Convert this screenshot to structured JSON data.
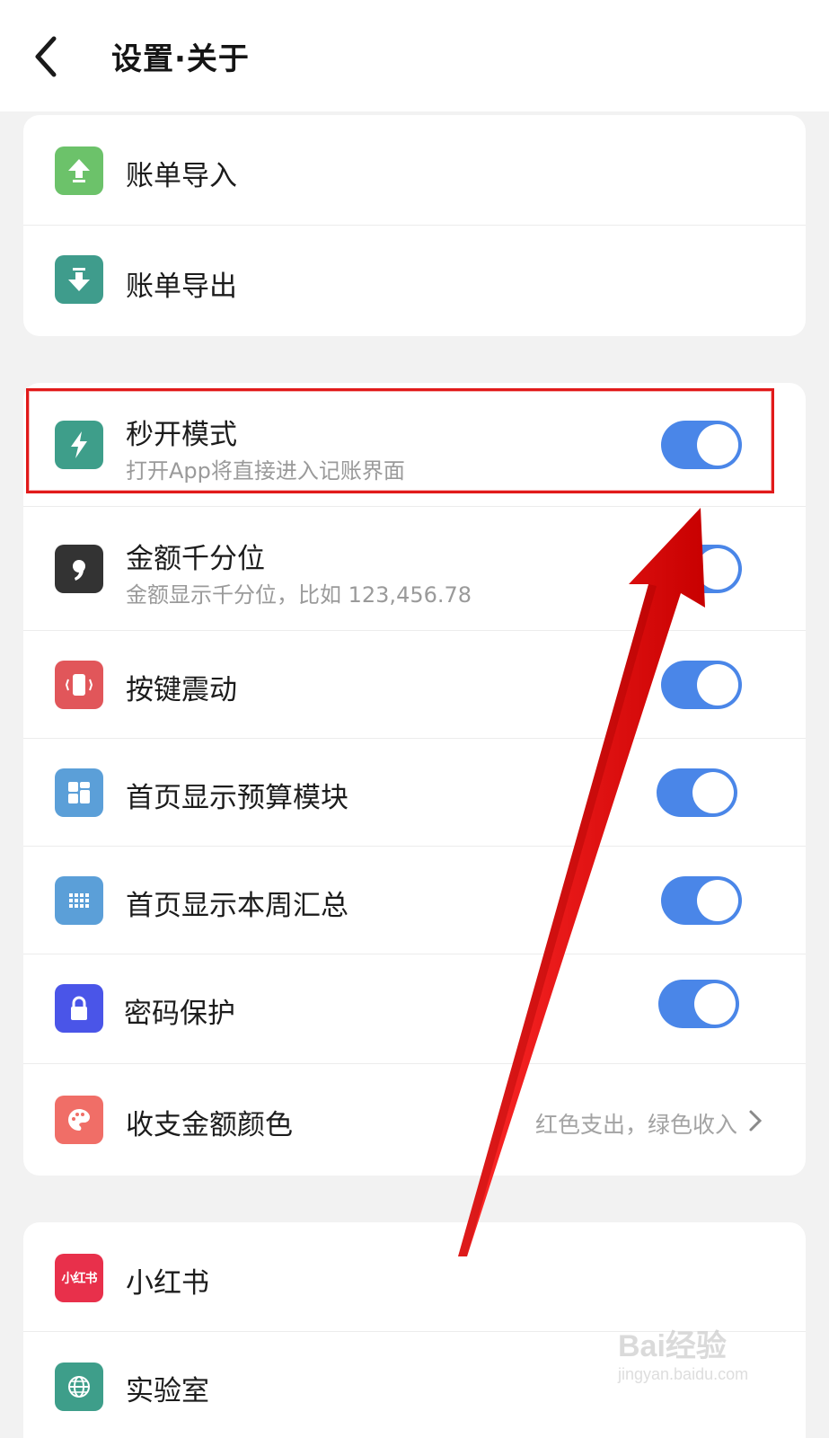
{
  "header": {
    "title": "设置·关于",
    "back_icon": "chevron-left-icon"
  },
  "card_data": {
    "items": [
      {
        "label": "账单导入",
        "icon": "upload-icon",
        "icon_color": "#6cc26a"
      },
      {
        "label": "账单导出",
        "icon": "download-icon",
        "icon_color": "#3f9c8c"
      }
    ]
  },
  "settings": {
    "items": [
      {
        "label": "秒开模式",
        "sublabel": "打开App将直接进入记账界面",
        "icon": "lightning-icon",
        "icon_color": "#3e9e8a",
        "toggle_on": true
      },
      {
        "label": "金额千分位",
        "sublabel": "金额显示千分位，比如 123,456.78",
        "icon": "comma-icon",
        "icon_color": "#333333",
        "toggle_on": true
      },
      {
        "label": "按键震动",
        "icon": "vibrate-phone-icon",
        "icon_color": "#e1565a",
        "toggle_on": true
      },
      {
        "label": "首页显示预算模块",
        "icon": "grid-icon",
        "icon_color": "#5b9fd8",
        "toggle_on": true
      },
      {
        "label": "首页显示本周汇总",
        "icon": "calendar-dots-icon",
        "icon_color": "#5b9fd8",
        "toggle_on": true
      },
      {
        "label": "密码保护",
        "icon": "lock-icon",
        "icon_color": "#4a55e8",
        "toggle_on": true
      },
      {
        "label": "收支金额颜色",
        "value": "红色支出，绿色收入",
        "icon": "palette-icon",
        "icon_color": "#f06e67"
      }
    ]
  },
  "links": {
    "items": [
      {
        "label": "小红书",
        "icon": "xiaohongshu-logo-icon",
        "icon_text": "小红书",
        "icon_color": "#e8304b"
      },
      {
        "label": "实验室",
        "icon": "globe-icon",
        "icon_color": "#3e9e8a"
      }
    ]
  },
  "accent_color": "#4a86e8",
  "annotation_color": "#e11a1a",
  "watermark": {
    "text": "Bai经验",
    "subtext": "jingyan.baidu.com"
  }
}
